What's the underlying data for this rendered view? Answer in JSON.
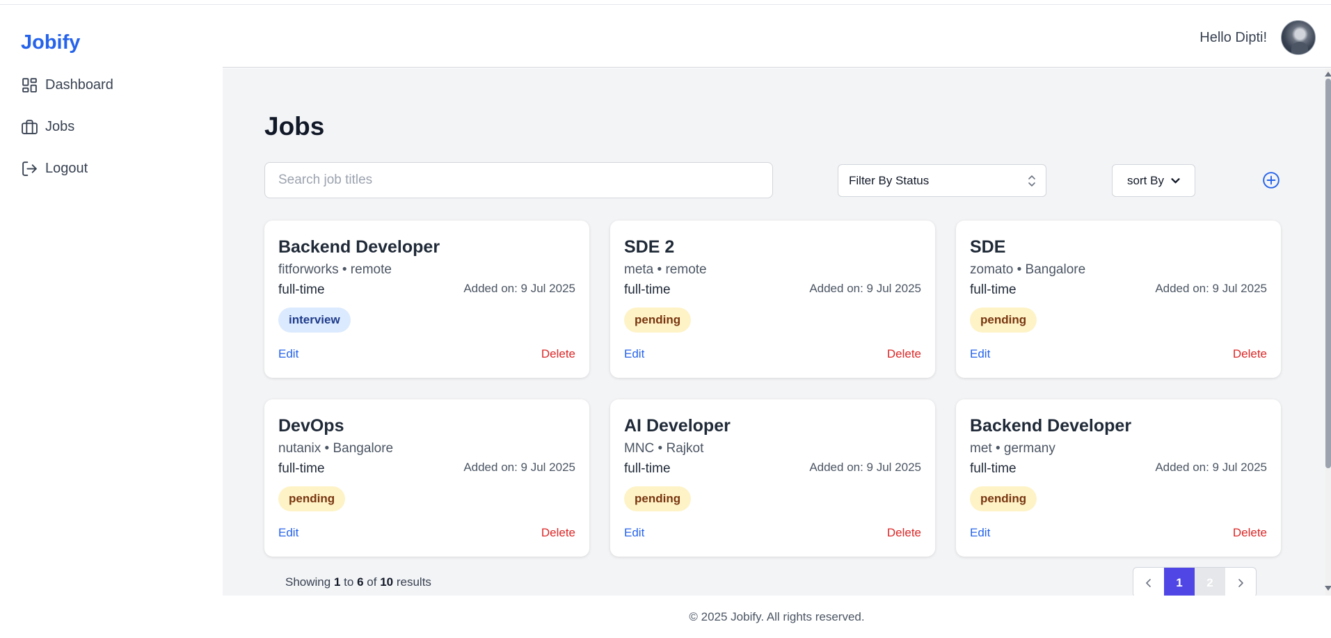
{
  "brand": "Jobify",
  "sidebar": {
    "items": [
      {
        "label": "Dashboard",
        "icon": "dashboard-icon"
      },
      {
        "label": "Jobs",
        "icon": "briefcase-icon"
      },
      {
        "label": "Logout",
        "icon": "logout-icon"
      }
    ]
  },
  "header": {
    "greeting": "Hello Dipti!"
  },
  "main": {
    "title": "Jobs",
    "search_placeholder": "Search job titles",
    "search_value": "",
    "filter_label": "Filter By Status",
    "sort_label": "sort By"
  },
  "jobs": [
    {
      "title": "Backend Developer",
      "company": "fitforworks",
      "location": "remote",
      "type": "full-time",
      "date": "Added on: 9 Jul 2025",
      "status": "interview",
      "edit": "Edit",
      "delete": "Delete"
    },
    {
      "title": "SDE 2",
      "company": "meta",
      "location": "remote",
      "type": "full-time",
      "date": "Added on: 9 Jul 2025",
      "status": "pending",
      "edit": "Edit",
      "delete": "Delete"
    },
    {
      "title": "SDE",
      "company": "zomato",
      "location": "Bangalore",
      "type": "full-time",
      "date": "Added on: 9 Jul 2025",
      "status": "pending",
      "edit": "Edit",
      "delete": "Delete"
    },
    {
      "title": "DevOps",
      "company": "nutanix",
      "location": "Bangalore",
      "type": "full-time",
      "date": "Added on: 9 Jul 2025",
      "status": "pending",
      "edit": "Edit",
      "delete": "Delete"
    },
    {
      "title": "AI Developer",
      "company": "MNC",
      "location": "Rajkot",
      "type": "full-time",
      "date": "Added on: 9 Jul 2025",
      "status": "pending",
      "edit": "Edit",
      "delete": "Delete"
    },
    {
      "title": "Backend Developer",
      "company": "met",
      "location": "germany",
      "type": "full-time",
      "date": "Added on: 9 Jul 2025",
      "status": "pending",
      "edit": "Edit",
      "delete": "Delete"
    }
  ],
  "pagination": {
    "showing_prefix": "Showing",
    "from": "1",
    "to_word": "to",
    "to": "6",
    "of_word": "of",
    "total": "10",
    "results_word": "results",
    "pages": [
      "1",
      "2"
    ],
    "current_page": "1"
  },
  "footer": "© 2025 Jobify. All rights reserved.",
  "colors": {
    "brand": "#2563eb",
    "delete": "#dc2626",
    "active_page": "#4f46e5",
    "pending_badge": "#fef3c7",
    "interview_badge": "#dbeafe"
  }
}
